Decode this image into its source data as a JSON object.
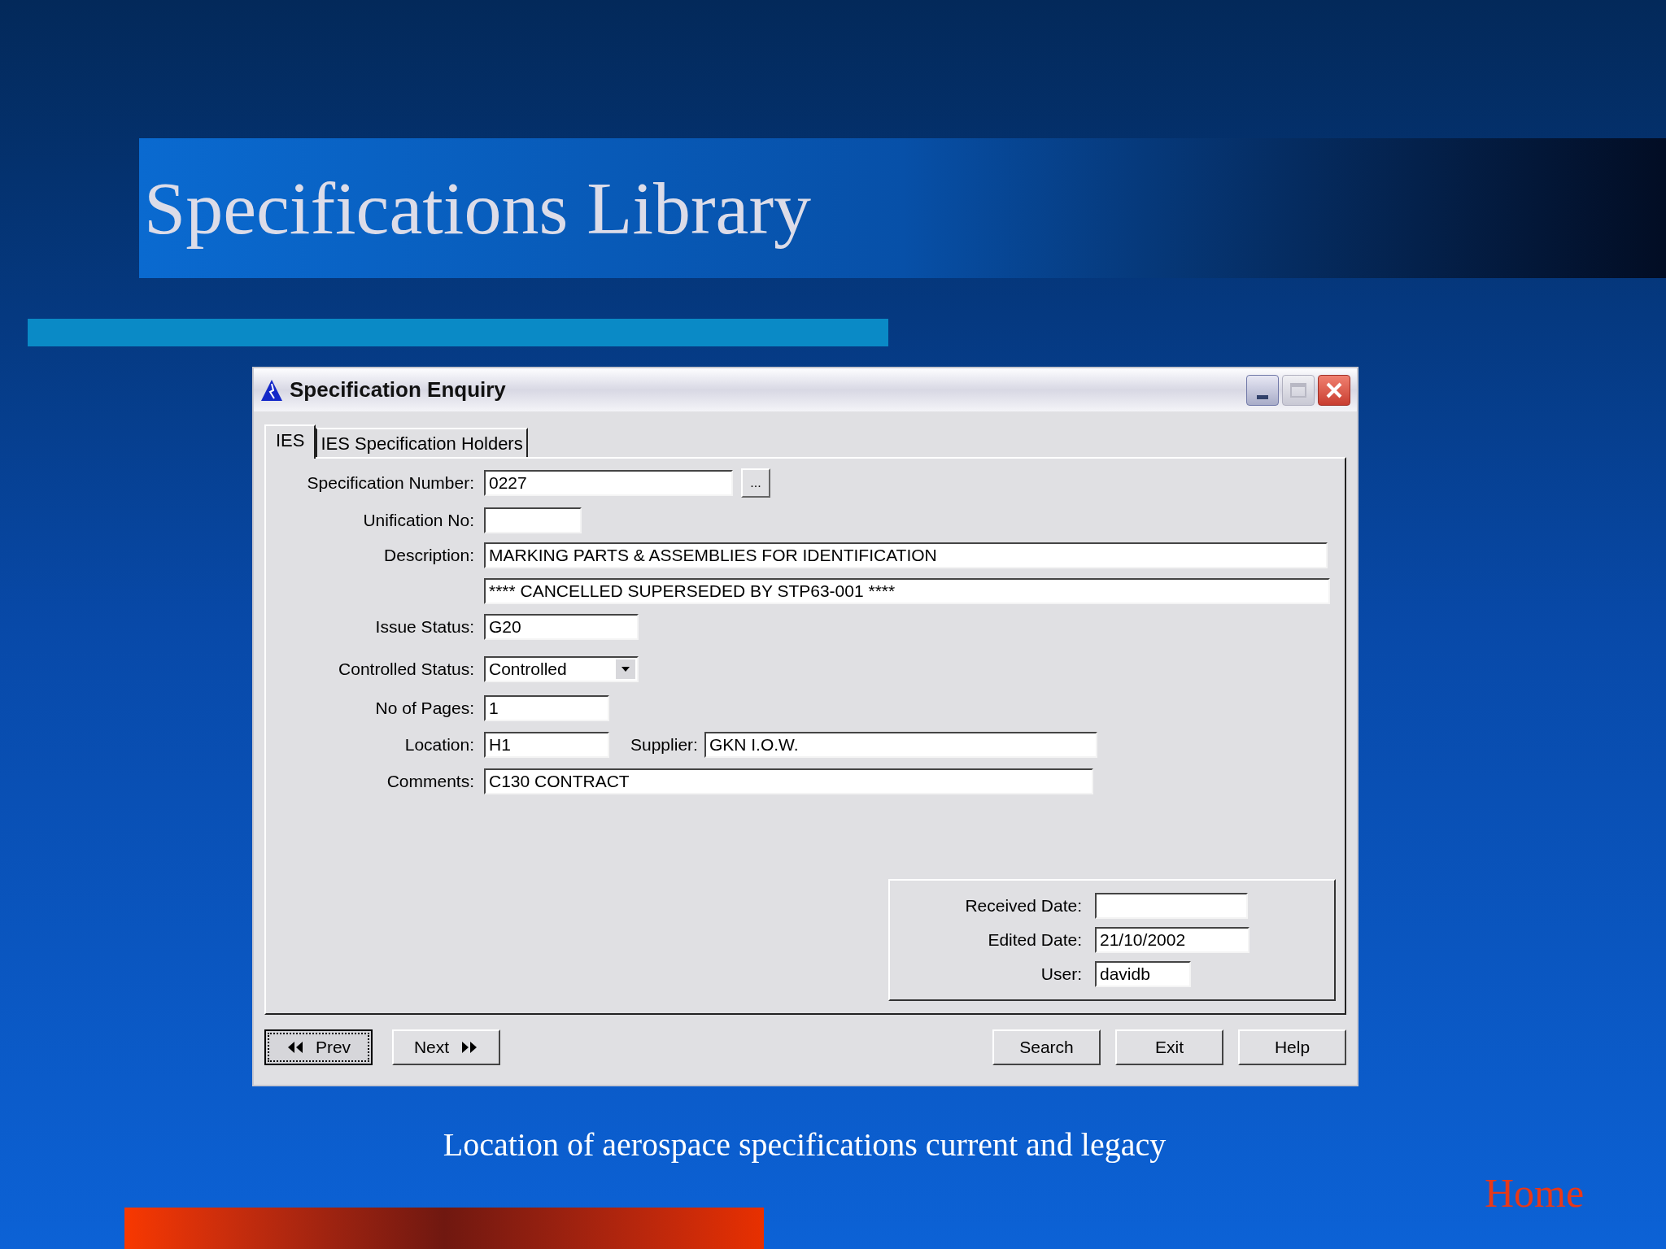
{
  "slide": {
    "title": "Specifications Library",
    "caption": "Location of aerospace specifications current and legacy",
    "home_link": "Home"
  },
  "window": {
    "title": "Specification Enquiry"
  },
  "tabs": [
    {
      "label": "IES",
      "selected": true
    },
    {
      "label": "IES Specification Holders",
      "selected": false
    }
  ],
  "form_rows": [
    {
      "fields": [
        {
          "label": "Specification Number:",
          "value": "0227",
          "kind": "browse",
          "button": "..."
        }
      ]
    },
    {
      "fields": [
        {
          "label": "Unification No:",
          "kind": "text"
        }
      ]
    },
    {
      "fields": [
        {
          "label": "Description:",
          "value": "MARKING PARTS & ASSEMBLIES FOR IDENTIFICATION",
          "kind": "text"
        }
      ]
    },
    {
      "fields": [
        {
          "value": "**** CANCELLED SUPERSEDED BY STP63-001 ****",
          "kind": "text"
        }
      ]
    },
    {
      "fields": [
        {
          "label": "Issue Status:",
          "value": "G20",
          "kind": "text"
        }
      ]
    },
    {
      "fields": [
        {
          "label": "Controlled Status:",
          "value": "Controlled",
          "kind": "combo"
        }
      ]
    },
    {
      "fields": [
        {
          "label": "No of Pages:",
          "value": "1",
          "kind": "text"
        }
      ]
    },
    {
      "fields": [
        {
          "label": "Location:",
          "value": "H1",
          "kind": "text"
        },
        {
          "label": "Supplier:",
          "value": "GKN I.O.W.",
          "kind": "text"
        }
      ]
    },
    {
      "fields": [
        {
          "label": "Comments:",
          "value": "C130 CONTRACT",
          "kind": "text"
        }
      ]
    }
  ],
  "dates": [
    {
      "label": "Received Date:"
    },
    {
      "label": "Edited Date:",
      "value": "21/10/2002"
    },
    {
      "label": "User:",
      "value": "davidb"
    }
  ],
  "nav_buttons": [
    {
      "label": "Prev",
      "kind": "prev",
      "focused": true
    },
    {
      "label": "Next",
      "kind": "next",
      "focused": false
    }
  ],
  "action_buttons": [
    "Search",
    "Exit",
    "Help"
  ]
}
